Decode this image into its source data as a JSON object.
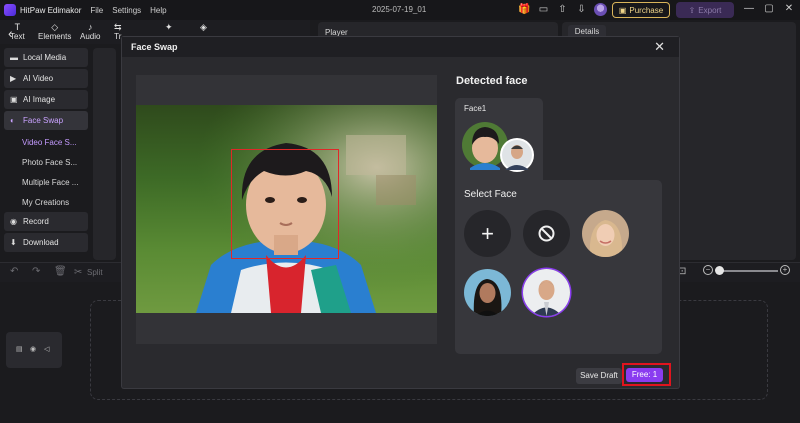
{
  "app": {
    "title": "HitPaw Edimakor",
    "menu": [
      "File",
      "Settings",
      "Help"
    ],
    "document_title": "2025-07-19_01",
    "purchase_label": "Purchase",
    "export_label": "Export"
  },
  "toolbar": {
    "tools": [
      {
        "label": "Text",
        "icon": "text-icon"
      },
      {
        "label": "Elements",
        "icon": "elements-icon"
      },
      {
        "label": "Audio",
        "icon": "audio-icon"
      },
      {
        "label": "Tr",
        "icon": "transition-icon"
      },
      {
        "label": "",
        "icon": "effects-icon"
      },
      {
        "label": "",
        "icon": "filter-icon"
      }
    ]
  },
  "sidebar": {
    "items": [
      {
        "label": "Local Media",
        "icon": "folder-icon"
      },
      {
        "label": "AI Video",
        "icon": "video-icon"
      },
      {
        "label": "AI Image",
        "icon": "image-icon"
      },
      {
        "label": "Face Swap",
        "icon": "face-swap-icon",
        "active": true
      }
    ],
    "sub_items": [
      {
        "label": "Video Face S...",
        "active": true
      },
      {
        "label": "Photo Face S..."
      },
      {
        "label": "Multiple Face ..."
      },
      {
        "label": "My Creations"
      }
    ],
    "bottom_items": [
      {
        "label": "Record",
        "icon": "record-icon"
      },
      {
        "label": "Download",
        "icon": "download-icon"
      }
    ]
  },
  "panels": {
    "player_label": "Player",
    "details_tab": "Details",
    "split_label": "Split"
  },
  "dialog": {
    "title": "Face Swap",
    "detected_face_title": "Detected face",
    "face_card_label": "Face1",
    "select_face_title": "Select Face",
    "save_draft_label": "Save Draft",
    "free_label": "Free: 1"
  },
  "colors": {
    "accent": "#8a3cf0",
    "highlight": "#e0141e",
    "face_box": "#e02828",
    "purchase_gold": "#d9b45a"
  }
}
